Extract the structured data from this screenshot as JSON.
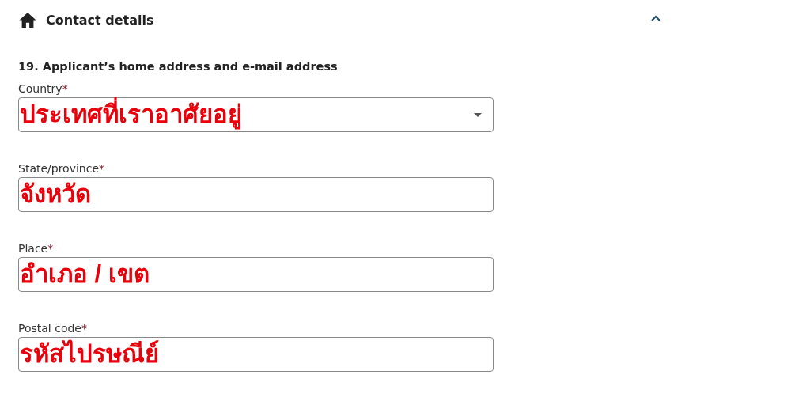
{
  "section": {
    "title": "Contact details",
    "expanded": true
  },
  "question": {
    "title": "19. Applicant’s home address and e-mail address"
  },
  "fields": [
    {
      "kind": "select",
      "label": "Country",
      "required_mark": "*",
      "annotation": "ประเทศที่เราอาศัยอยู่"
    },
    {
      "kind": "text",
      "label": "State/province",
      "required_mark": "*",
      "annotation": "จังหวัด"
    },
    {
      "kind": "text",
      "label": "Place",
      "required_mark": "*",
      "annotation": "อำเภอ / เขต"
    },
    {
      "kind": "text",
      "label": "Postal code",
      "required_mark": "*",
      "annotation": "รหัสไปรษณีย์"
    }
  ]
}
